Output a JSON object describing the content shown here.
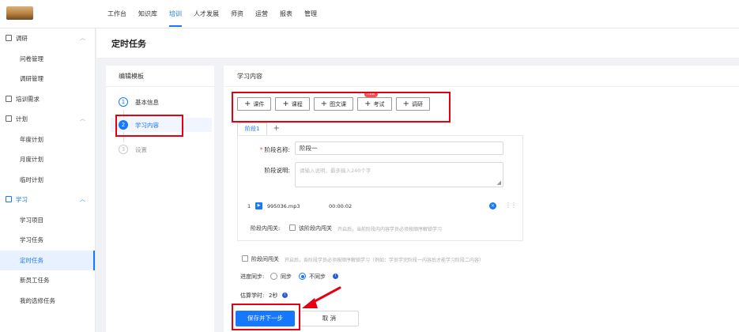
{
  "topnav": [
    "工作台",
    "知识库",
    "培训",
    "人才发展",
    "师资",
    "运营",
    "报表",
    "管理"
  ],
  "sidebar": {
    "g_research": "调研",
    "c_questionnaire": "问卷管理",
    "c_research_mgmt": "调研管理",
    "g_demand": "培训需求",
    "g_plan": "计划",
    "c_annual": "年度计划",
    "c_monthly": "月度计划",
    "c_temporary": "临时计划",
    "g_learning": "学习",
    "c_project": "学习项目",
    "c_task": "学习任务",
    "c_scheduled": "定时任务",
    "c_newhire": "新员工任务",
    "c_elective": "我的选修任务"
  },
  "page_title": "定时任务",
  "steps": {
    "head": "编辑模板",
    "s1_num": "1",
    "s1_label": "基本信息",
    "s2_num": "2",
    "s2_label": "学习内容",
    "s3_num": "3",
    "s3_label": "设置"
  },
  "content": {
    "head": "学习内容",
    "buttons": {
      "plus": "+",
      "courseware": "课件",
      "course": "课程",
      "article": "图文课",
      "exam": "考试",
      "research": "调研",
      "new_badge": "new"
    },
    "tab_stage1": "阶段1",
    "tab_add": "+",
    "stage_name_req": "*",
    "stage_name_label": "阶段名称:",
    "stage_name_value": "阶段一",
    "stage_desc_label": "阶段说明:",
    "stage_desc_placeholder": "请输入说明，最多输入240个字",
    "file": {
      "index": "1",
      "icon": "▶",
      "name": "995036.mp3",
      "duration": "00:00:02",
      "close": "×",
      "drag": "⋮⋮"
    },
    "stage_gate_label": "阶段内闯关:",
    "stage_gate_text": "该阶段内闯关",
    "stage_gate_hint": "开启后，当前阶段内内容学员必须按顺序解锁学习",
    "between_gate_text": "阶段间闯关",
    "between_gate_hint": "开启后，各阶段学员必须按顺序解锁学习（例如：学员学完阶段一内容后才能学习阶段二内容）",
    "sync_label": "进度同步:",
    "sync_on": "同步",
    "sync_off": "不同步",
    "info_icon": "i",
    "est_label": "估算学时:",
    "est_value": "2秒",
    "save_next": "保存并下一步",
    "cancel": "取 消"
  }
}
